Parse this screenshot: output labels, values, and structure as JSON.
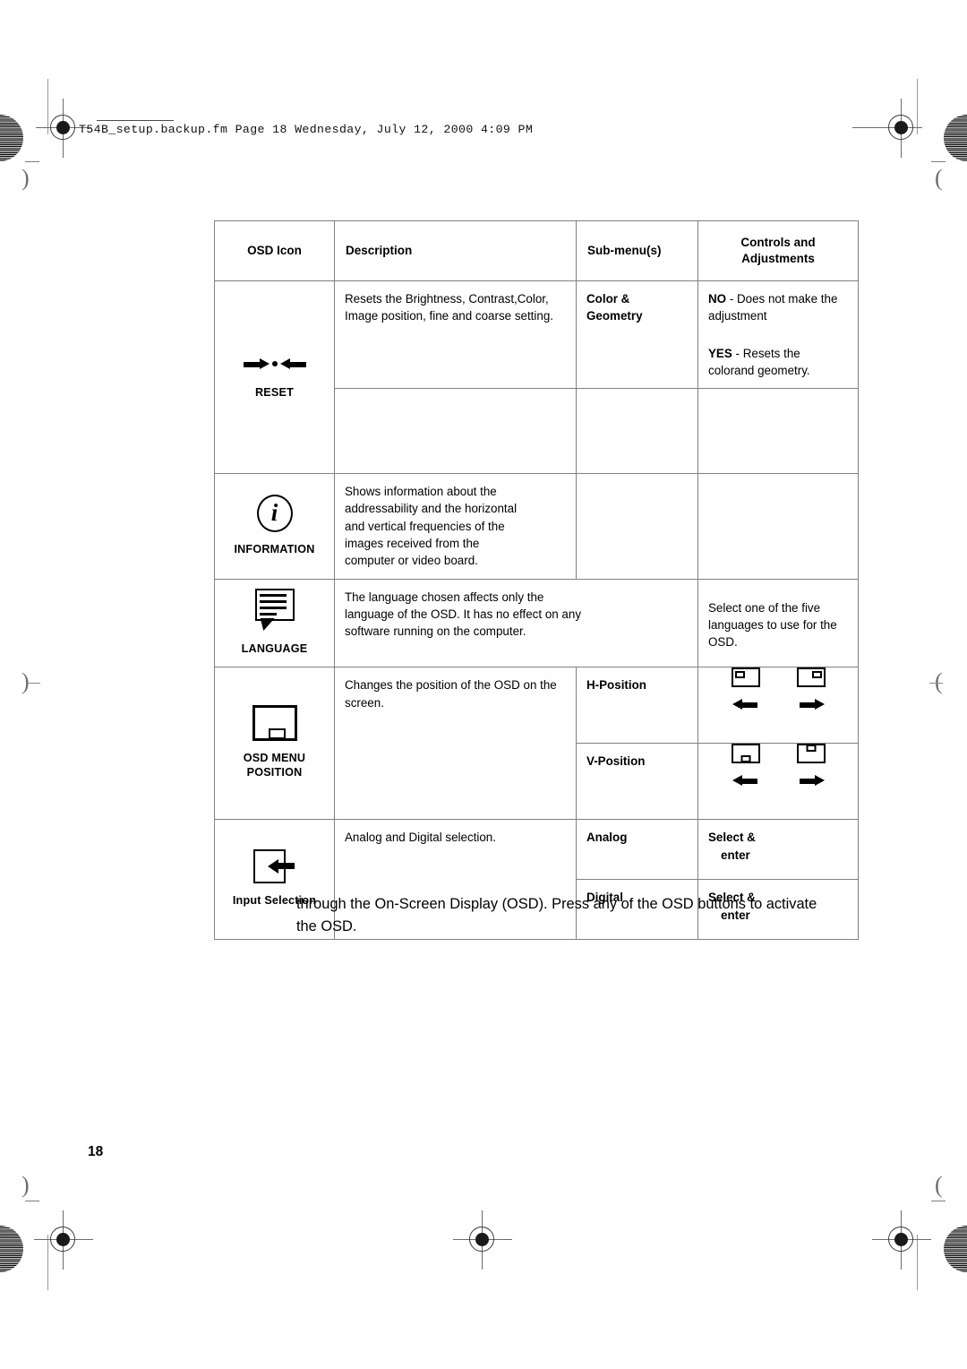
{
  "document": {
    "file_header": "T54B_setup.backup.fm  Page 18  Wednesday, July 12, 2000  4:09 PM",
    "page_number": "18",
    "body_paragraph": "through the On-Screen Display (OSD). Press any of the OSD buttons to activate the OSD."
  },
  "table": {
    "headers": {
      "osd_icon": "OSD Icon",
      "description": "Description",
      "sub_menus": "Sub-menu(s)",
      "controls": "Controls and Adjustments",
      "controls_line1": "Controls and",
      "controls_line2": "Adjustments"
    },
    "rows": [
      {
        "icon_name": "reset-icon",
        "icon_label": "RESET",
        "description": "Resets the Brightness, Contrast,Color, Image position, fine and coarse setting.",
        "sub_menu": "Color & Geometry",
        "sub_menu_line1": "Color &",
        "sub_menu_line2": "Geometry",
        "control_1_bold": "NO",
        "control_1_rest": " - Does not make the adjustment",
        "control_2_bold": "YES",
        "control_2_rest": " - Resets the colorand geometry."
      },
      {
        "icon_name": "information-icon",
        "icon_label": "INFORMATION",
        "icon_char": "i",
        "description": "Shows information about the addressability and the horizontal and vertical frequencies of the images received from the computer or video board."
      },
      {
        "icon_name": "language-icon",
        "icon_label": "LANGUAGE",
        "description": "The language chosen affects only the language of the OSD. It has no effect on any software running on the computer.",
        "controls": "Select one of the five languages to use for the OSD."
      },
      {
        "icon_name": "osd-menu-position-icon",
        "icon_label_line1": "OSD MENU",
        "icon_label_line2": "POSITION",
        "description": "Changes the position of the OSD on the screen.",
        "sub_menu_h": "H-Position",
        "sub_menu_v": "V-Position"
      },
      {
        "icon_name": "input-selection-icon",
        "icon_label": "Input Selection",
        "description": "Analog and Digital selection.",
        "sub_menu_analog": "Analog",
        "sub_menu_digital": "Digital",
        "control_analog_line1": "Select &",
        "control_analog_line2": "enter",
        "control_digital_line1": "Select &",
        "control_digital_line2": "enter"
      }
    ]
  },
  "colors": {
    "border": "#808080",
    "text": "#000000",
    "page_background": "#ffffff",
    "registration_mark": "#6b6b6b"
  }
}
